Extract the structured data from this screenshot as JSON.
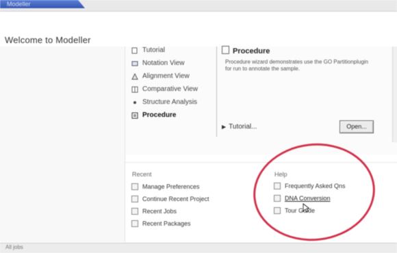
{
  "window": {
    "tab_title": "Modeller"
  },
  "header": {
    "title": "Welcome to Modeller"
  },
  "nav": {
    "items": [
      {
        "label": "Tutorial",
        "icon": "document-icon"
      },
      {
        "label": "Notation View",
        "icon": "view-icon"
      },
      {
        "label": "Alignment View",
        "icon": "alignment-icon"
      },
      {
        "label": "Comparative View",
        "icon": "compare-icon"
      },
      {
        "label": "Structure Analysis",
        "icon": "bullet-icon"
      },
      {
        "label": "Procedure",
        "icon": "procedure-icon"
      }
    ],
    "selected_index": 5
  },
  "procedure": {
    "title": "Procedure",
    "description": "Procedure wizard demonstrates use the GO Partitionplugin for run to annotate the sample.",
    "tutorial_link": "Tutorial...",
    "open_button": "Open..."
  },
  "recent": {
    "heading": "Recent",
    "items": [
      "Manage Preferences",
      "Continue Recent Project",
      "Recent Jobs",
      "Recent Packages"
    ]
  },
  "help": {
    "heading": "Help",
    "items": [
      "Frequently Asked Qns",
      "DNA Conversion",
      "Tour Guide"
    ]
  },
  "status": {
    "text": "All jobs"
  },
  "colors": {
    "accent": "#3456b0",
    "highlight": "#c8102e"
  }
}
